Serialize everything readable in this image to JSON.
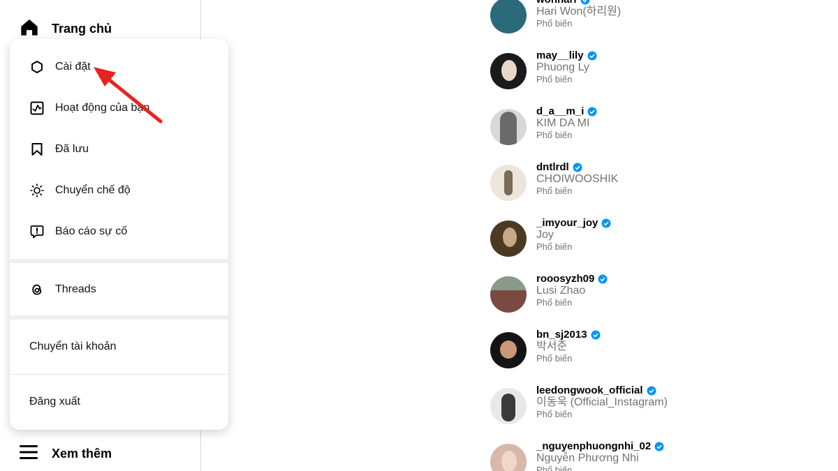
{
  "nav": {
    "home_label": "Trang chủ",
    "more_label": "Xem thêm"
  },
  "menu": {
    "items": [
      {
        "label": "Cài đặt",
        "icon": "settings-icon"
      },
      {
        "label": "Hoạt động của bạn",
        "icon": "activity-icon"
      },
      {
        "label": "Đã lưu",
        "icon": "bookmark-icon"
      },
      {
        "label": "Chuyển chế độ",
        "icon": "sun-icon"
      },
      {
        "label": "Báo cáo sự cố",
        "icon": "report-icon"
      }
    ],
    "threads_label": "Threads",
    "switch_account_label": "Chuyển tài khoản",
    "logout_label": "Đăng xuất"
  },
  "accounts": [
    {
      "username": "wonhari",
      "fullname": "Hari Won(하리원)",
      "tag": "Phổ biến",
      "avatar_color": "#2a6a7a"
    },
    {
      "username": "may__lily",
      "fullname": "Phuong Ly",
      "tag": "Phổ biến",
      "avatar_color": "#1a1a1a"
    },
    {
      "username": "d_a__m_i",
      "fullname": "KIM DA MI",
      "tag": "Phổ biến",
      "avatar_color": "#9a9a9a"
    },
    {
      "username": "dntlrdl",
      "fullname": "CHOIWOOSHIK",
      "tag": "Phổ biến",
      "avatar_color": "#e8e2d6"
    },
    {
      "username": "_imyour_joy",
      "fullname": "Joy",
      "tag": "Phổ biến",
      "avatar_color": "#4a3a22"
    },
    {
      "username": "rooosyzh09",
      "fullname": "Lusi Zhao",
      "tag": "Phổ biến",
      "avatar_color": "#7a4a42"
    },
    {
      "username": "bn_sj2013",
      "fullname": "박서준",
      "tag": "Phổ biến",
      "avatar_color": "#141414"
    },
    {
      "username": "leedongwook_official",
      "fullname": "이동욱 (Official_Instagram)",
      "tag": "Phổ biến",
      "avatar_color": "#3a3a3a"
    },
    {
      "username": "_nguyenphuongnhi_02",
      "fullname": "Nguyễn Phương Nhi",
      "tag": "Phổ biến",
      "avatar_color": "#c89a88"
    }
  ],
  "colors": {
    "verified": "#0095f6",
    "annotation_arrow": "#e8231f"
  }
}
